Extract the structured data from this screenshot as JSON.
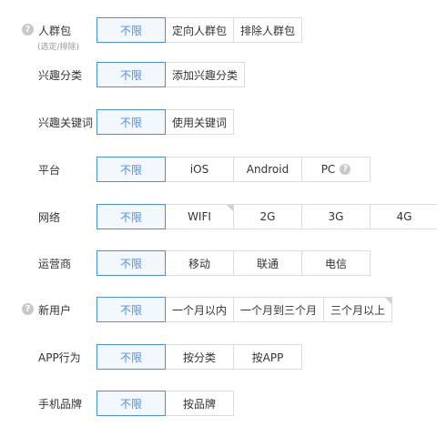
{
  "rows": [
    {
      "label": "人群包",
      "sublabel": "(选定/排除)",
      "options": [
        "不限",
        "定向人群包",
        "排除人群包"
      ]
    },
    {
      "label": "兴趣分类",
      "options": [
        "不限",
        "添加兴趣分类"
      ]
    },
    {
      "label": "兴趣关键词",
      "options": [
        "不限",
        "使用关键词"
      ]
    },
    {
      "label": "平台",
      "options": [
        "不限",
        "iOS",
        "Android",
        "PC"
      ]
    },
    {
      "label": "网络",
      "options": [
        "不限",
        "WIFI",
        "2G",
        "3G",
        "4G"
      ]
    },
    {
      "label": "运营商",
      "options": [
        "不限",
        "移动",
        "联通",
        "电信"
      ]
    },
    {
      "label": "新用户",
      "options": [
        "不限",
        "一个月以内",
        "一个月到三个月",
        "三个月以上"
      ]
    },
    {
      "label": "APP行为",
      "options": [
        "不限",
        "按分类",
        "按APP"
      ]
    },
    {
      "label": "手机品牌",
      "options": [
        "不限",
        "按品牌"
      ]
    }
  ],
  "help_glyph": "?",
  "colors": {
    "accent": "#4a90e2",
    "selected_bg": "#f3f8fe",
    "border": "#dcdcdc",
    "label_text": "#333333",
    "sublabel_text": "#999999",
    "help_icon_bg": "#c8c8c8"
  }
}
